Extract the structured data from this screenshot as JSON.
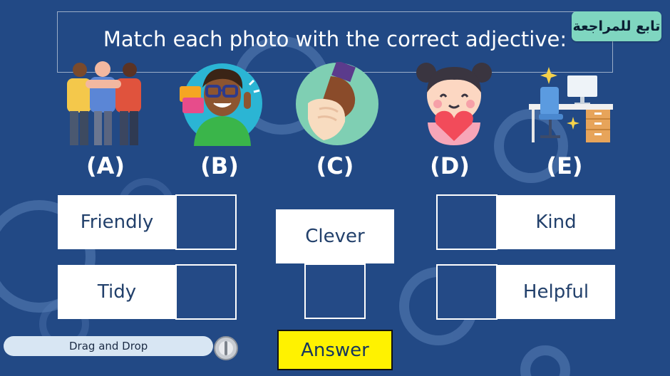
{
  "title": "Match each photo with the correct adjective:",
  "review_button": "تابع للمراجعة",
  "letters": [
    "(A)",
    "(B)",
    "(C)",
    "(D)",
    "(E)"
  ],
  "words": {
    "friendly": "Friendly",
    "tidy": "Tidy",
    "clever": "Clever",
    "kind": "Kind",
    "helpful": "Helpful"
  },
  "footer": {
    "drag_label": "Drag and Drop",
    "answer_button": "Answer"
  },
  "colors": {
    "background": "#224985",
    "review_button": "#7fd6c0",
    "answer_button": "#fff200"
  },
  "icons": [
    "friends-group-icon",
    "clever-boy-icon",
    "helping-hands-icon",
    "kind-girl-heart-icon",
    "tidy-desk-icon"
  ]
}
